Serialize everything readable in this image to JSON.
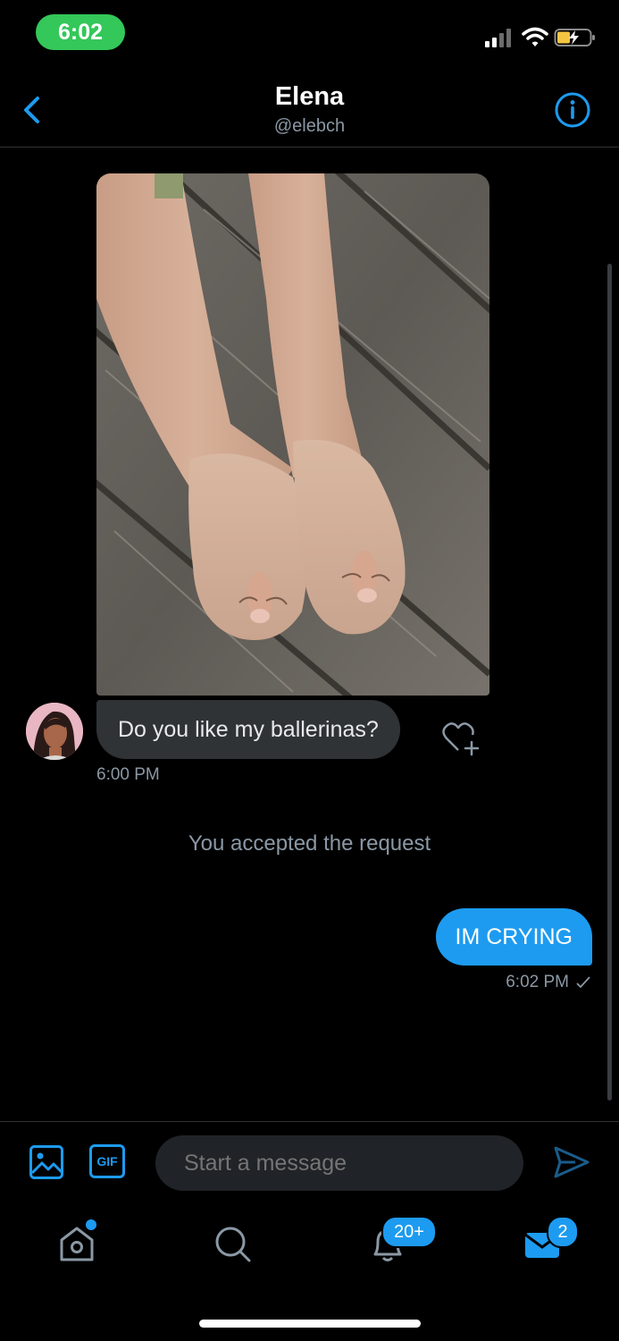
{
  "status": {
    "time": "6:02"
  },
  "header": {
    "name": "Elena",
    "handle": "@elebch"
  },
  "messages": {
    "incoming_text": "Do you like my ballerinas?",
    "incoming_time": "6:00 PM",
    "system_notice": "You accepted the request",
    "outgoing_text": "IM CRYING",
    "outgoing_time": "6:02 PM",
    "outgoing_status_icon": "checkmark-icon"
  },
  "composer": {
    "placeholder": "Start a message",
    "gif_label": "GIF"
  },
  "tabbar": {
    "notifications_badge": "20+",
    "messages_badge": "2"
  },
  "colors": {
    "accent": "#1d9bf0",
    "bubble_in": "#2f3336",
    "muted": "#8b98a5",
    "status_green": "#34c759"
  }
}
